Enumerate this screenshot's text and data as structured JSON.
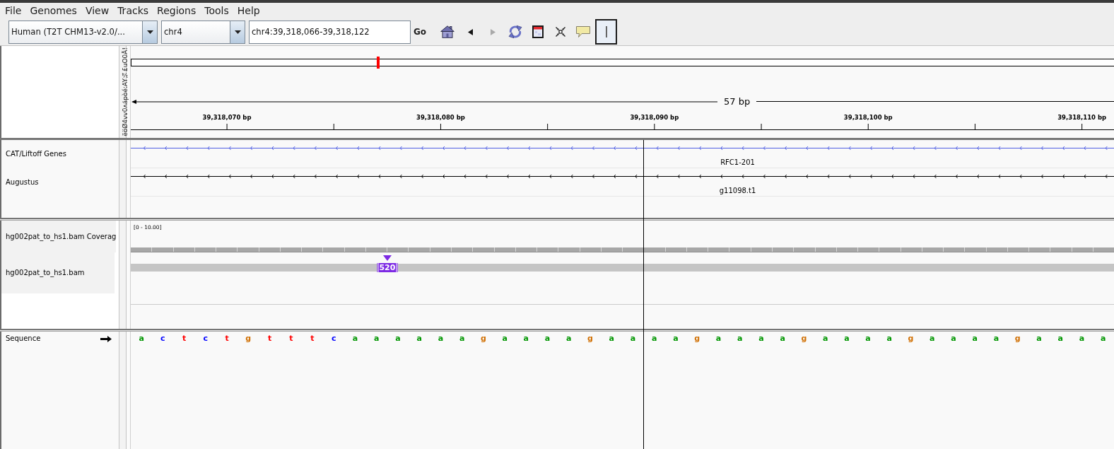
{
  "menu": [
    {
      "label": "File"
    },
    {
      "label": "Genomes"
    },
    {
      "label": "View"
    },
    {
      "label": "Tracks"
    },
    {
      "label": "Regions"
    },
    {
      "label": "Tools"
    },
    {
      "label": "Help"
    }
  ],
  "toolbar": {
    "genome_dropdown": {
      "value": "Human (T2T CHM13-v2.0/..."
    },
    "chromosome_dropdown": {
      "value": "chr4"
    },
    "locus_field": {
      "value": "chr4:39,318,066-39,318,122"
    },
    "go_button": "Go",
    "tools": [
      {
        "kind": "home",
        "disabled": false,
        "selected": false
      },
      {
        "kind": "back",
        "disabled": false,
        "selected": false
      },
      {
        "kind": "forward",
        "disabled": true,
        "selected": false
      },
      {
        "kind": "refresh",
        "disabled": false,
        "selected": false
      },
      {
        "kind": "region",
        "disabled": false,
        "selected": false
      },
      {
        "kind": "fit",
        "disabled": false,
        "selected": false
      },
      {
        "kind": "popup",
        "disabled": false,
        "selected": false
      },
      {
        "kind": "ruler",
        "disabled": false,
        "selected": true
      }
    ]
  },
  "header": {
    "attribute_header": "ëöØ4vv0ʌápòé:AY¼£uO0Ä!",
    "span_label": "57 bp",
    "ticks": [
      "39,318,070 bp",
      "39,318,080 bp",
      "39,318,090 bp",
      "39,318,100 bp",
      "39,318,110 bp"
    ]
  },
  "feature_tracks": [
    {
      "name": "CAT/Liftoff Genes",
      "color": "#4f5fe3",
      "feature_label": "RFC1-201"
    },
    {
      "name": "Augustus",
      "color": "#000000",
      "feature_label": "g11098.t1"
    }
  ],
  "alignment_tracks": [
    {
      "kind": "coverage",
      "name": "hg002pat_to_hs1.bam Coverag",
      "range": "[0 - 10.00]"
    },
    {
      "kind": "alignments",
      "name": "hg002pat_to_hs1.bam",
      "insertion_label": "520"
    }
  ],
  "sequence_track": {
    "name": "Sequence",
    "bases": [
      {
        "base": "a",
        "color": "#009600"
      },
      {
        "base": "c",
        "color": "#0000ff"
      },
      {
        "base": "t",
        "color": "#ff0000"
      },
      {
        "base": "c",
        "color": "#0000ff"
      },
      {
        "base": "t",
        "color": "#ff0000"
      },
      {
        "base": "g",
        "color": "#d17105"
      },
      {
        "base": "t",
        "color": "#ff0000"
      },
      {
        "base": "t",
        "color": "#ff0000"
      },
      {
        "base": "t",
        "color": "#ff0000"
      },
      {
        "base": "c",
        "color": "#0000ff"
      },
      {
        "base": "a",
        "color": "#009600"
      },
      {
        "base": "a",
        "color": "#009600"
      },
      {
        "base": "a",
        "color": "#009600"
      },
      {
        "base": "a",
        "color": "#009600"
      },
      {
        "base": "a",
        "color": "#009600"
      },
      {
        "base": "a",
        "color": "#009600"
      },
      {
        "base": "g",
        "color": "#d17105"
      },
      {
        "base": "a",
        "color": "#009600"
      },
      {
        "base": "a",
        "color": "#009600"
      },
      {
        "base": "a",
        "color": "#009600"
      },
      {
        "base": "a",
        "color": "#009600"
      },
      {
        "base": "g",
        "color": "#d17105"
      },
      {
        "base": "a",
        "color": "#009600"
      },
      {
        "base": "a",
        "color": "#009600"
      },
      {
        "base": "a",
        "color": "#009600"
      },
      {
        "base": "a",
        "color": "#009600"
      },
      {
        "base": "g",
        "color": "#d17105"
      },
      {
        "base": "a",
        "color": "#009600"
      },
      {
        "base": "a",
        "color": "#009600"
      },
      {
        "base": "a",
        "color": "#009600"
      },
      {
        "base": "a",
        "color": "#009600"
      },
      {
        "base": "g",
        "color": "#d17105"
      },
      {
        "base": "a",
        "color": "#009600"
      },
      {
        "base": "a",
        "color": "#009600"
      },
      {
        "base": "a",
        "color": "#009600"
      },
      {
        "base": "a",
        "color": "#009600"
      },
      {
        "base": "g",
        "color": "#d17105"
      },
      {
        "base": "a",
        "color": "#009600"
      },
      {
        "base": "a",
        "color": "#009600"
      },
      {
        "base": "a",
        "color": "#009600"
      },
      {
        "base": "a",
        "color": "#009600"
      },
      {
        "base": "g",
        "color": "#d17105"
      },
      {
        "base": "a",
        "color": "#009600"
      },
      {
        "base": "a",
        "color": "#009600"
      },
      {
        "base": "a",
        "color": "#009600"
      },
      {
        "base": "a",
        "color": "#009600"
      }
    ]
  }
}
